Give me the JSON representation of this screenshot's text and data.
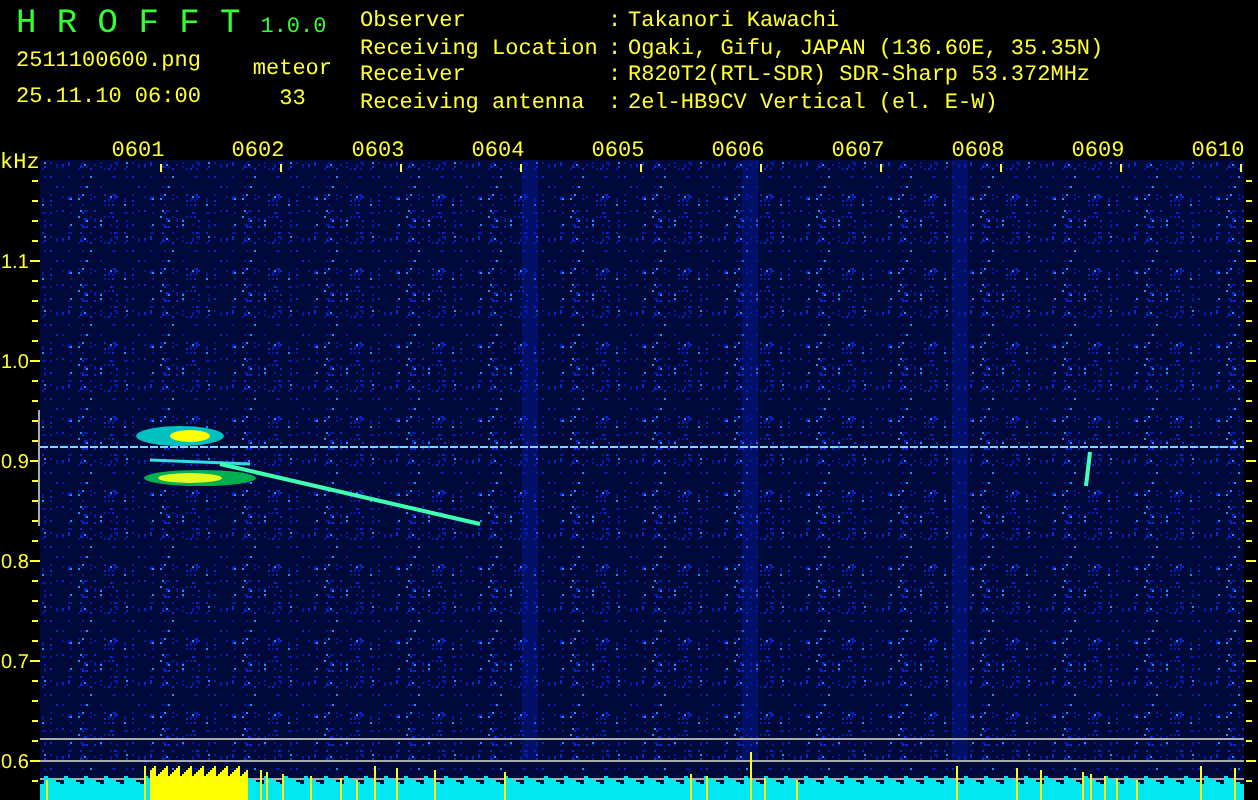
{
  "app": {
    "title": "H R O F F T",
    "version": "1.0.0"
  },
  "file": "2511100600.png",
  "datetime": "25.11.10 06:00",
  "meteor": {
    "label": "meteor",
    "count": "33"
  },
  "info": [
    {
      "label": "Observer",
      "separator": ":",
      "value": "Takanori Kawachi"
    },
    {
      "label": "Receiving Location",
      "separator": ":",
      "value": "Ogaki, Gifu, JAPAN (136.60E, 35.35N)"
    },
    {
      "label": "Receiver",
      "separator": ":",
      "value": "R820T2(RTL-SDR) SDR-Sharp 53.372MHz"
    },
    {
      "label": "Receiving antenna",
      "separator": ":",
      "value": "2el-HB9CV Vertical (el. E-W)"
    }
  ],
  "spectrogram": {
    "unit": "kHz",
    "time_labels": [
      "0601",
      "0602",
      "0603",
      "0604",
      "0605",
      "0606",
      "0607",
      "0608",
      "0609",
      "0610"
    ],
    "freq_labels": [
      "1.1",
      "1.0",
      "0.9",
      "0.8",
      "0.7",
      "0.6"
    ]
  }
}
